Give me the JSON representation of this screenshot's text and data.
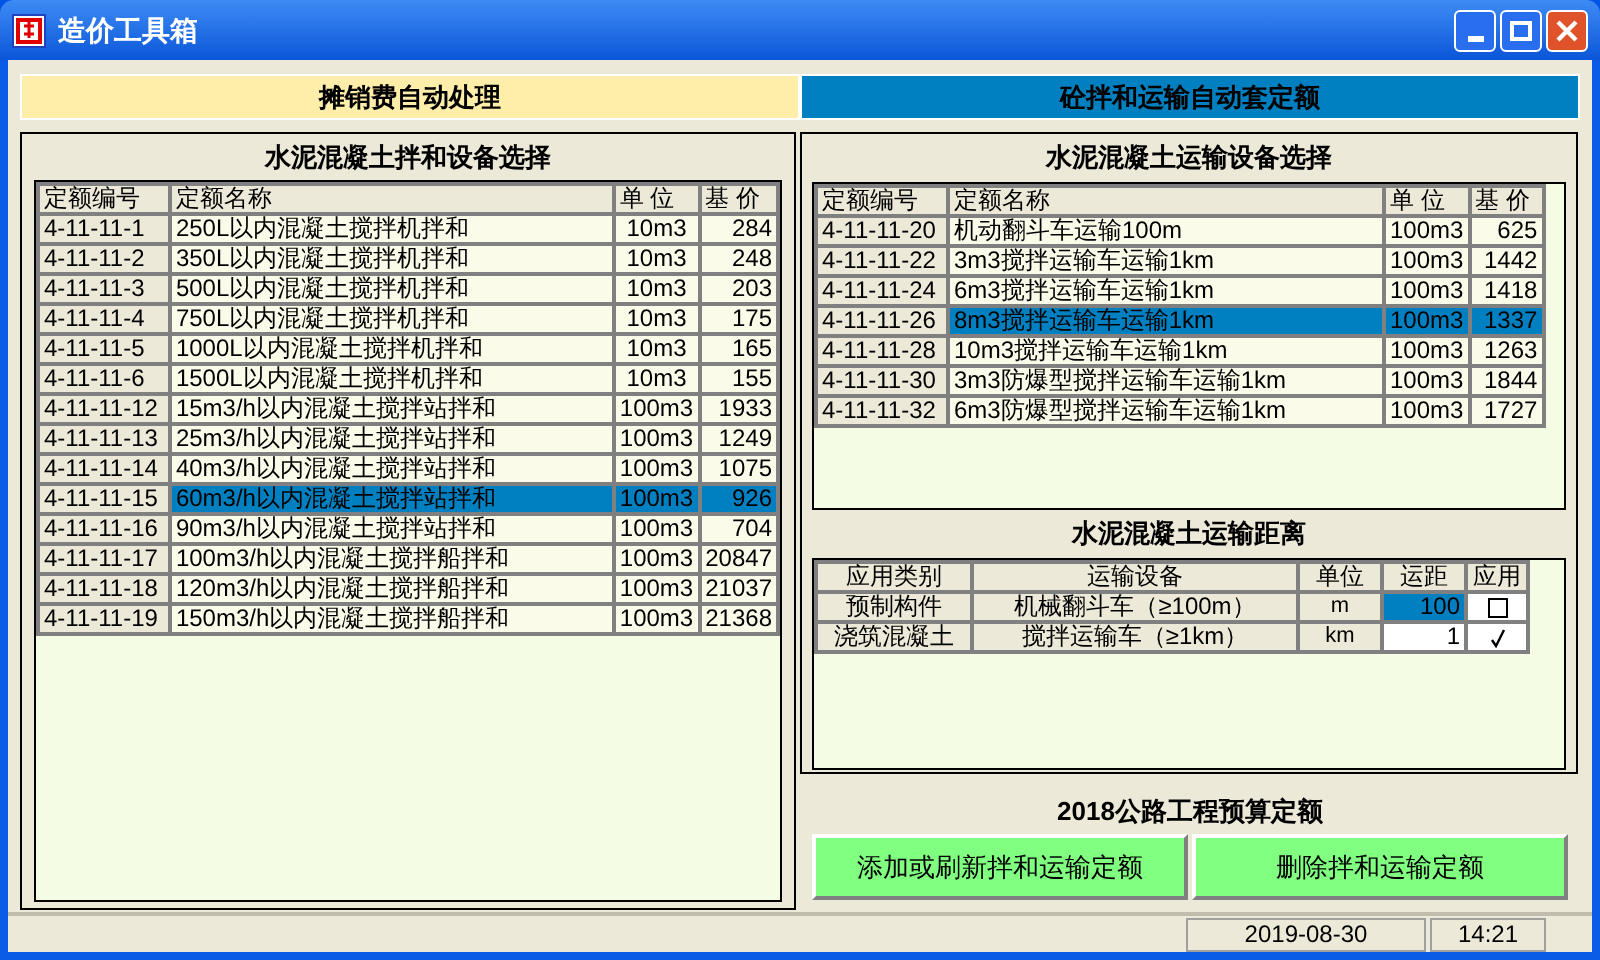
{
  "window": {
    "title": "造价工具箱"
  },
  "tabs": [
    {
      "label": "摊销费自动处理",
      "selected": false
    },
    {
      "label": "砼拌和运输自动套定额",
      "selected": true
    }
  ],
  "mix_panel": {
    "title": "水泥混凝土拌和设备选择",
    "columns": [
      "定额编号",
      "定额名称",
      "单 位",
      "基 价"
    ],
    "rows": [
      {
        "code": "4-11-11-1",
        "name": "250L以内混凝土搅拌机拌和",
        "unit": "10m3",
        "price": "284",
        "selected": false
      },
      {
        "code": "4-11-11-2",
        "name": "350L以内混凝土搅拌机拌和",
        "unit": "10m3",
        "price": "248",
        "selected": false
      },
      {
        "code": "4-11-11-3",
        "name": "500L以内混凝土搅拌机拌和",
        "unit": "10m3",
        "price": "203",
        "selected": false
      },
      {
        "code": "4-11-11-4",
        "name": "750L以内混凝土搅拌机拌和",
        "unit": "10m3",
        "price": "175",
        "selected": false
      },
      {
        "code": "4-11-11-5",
        "name": "1000L以内混凝土搅拌机拌和",
        "unit": "10m3",
        "price": "165",
        "selected": false
      },
      {
        "code": "4-11-11-6",
        "name": "1500L以内混凝土搅拌机拌和",
        "unit": "10m3",
        "price": "155",
        "selected": false
      },
      {
        "code": "4-11-11-12",
        "name": "15m3/h以内混凝土搅拌站拌和",
        "unit": "100m3",
        "price": "1933",
        "selected": false
      },
      {
        "code": "4-11-11-13",
        "name": "25m3/h以内混凝土搅拌站拌和",
        "unit": "100m3",
        "price": "1249",
        "selected": false
      },
      {
        "code": "4-11-11-14",
        "name": "40m3/h以内混凝土搅拌站拌和",
        "unit": "100m3",
        "price": "1075",
        "selected": false
      },
      {
        "code": "4-11-11-15",
        "name": "60m3/h以内混凝土搅拌站拌和",
        "unit": "100m3",
        "price": "926",
        "selected": true
      },
      {
        "code": "4-11-11-16",
        "name": "90m3/h以内混凝土搅拌站拌和",
        "unit": "100m3",
        "price": "704",
        "selected": false
      },
      {
        "code": "4-11-11-17",
        "name": "100m3/h以内混凝土搅拌船拌和",
        "unit": "100m3",
        "price": "20847",
        "selected": false
      },
      {
        "code": "4-11-11-18",
        "name": "120m3/h以内混凝土搅拌船拌和",
        "unit": "100m3",
        "price": "21037",
        "selected": false
      },
      {
        "code": "4-11-11-19",
        "name": "150m3/h以内混凝土搅拌船拌和",
        "unit": "100m3",
        "price": "21368",
        "selected": false
      }
    ]
  },
  "transport_panel": {
    "title": "水泥混凝土运输设备选择",
    "columns": [
      "定额编号",
      "定额名称",
      "单 位",
      "基 价"
    ],
    "rows": [
      {
        "code": "4-11-11-20",
        "name": "机动翻斗车运输100m",
        "unit": "100m3",
        "price": "625",
        "selected": false
      },
      {
        "code": "4-11-11-22",
        "name": "3m3搅拌运输车运输1km",
        "unit": "100m3",
        "price": "1442",
        "selected": false
      },
      {
        "code": "4-11-11-24",
        "name": "6m3搅拌运输车运输1km",
        "unit": "100m3",
        "price": "1418",
        "selected": false
      },
      {
        "code": "4-11-11-26",
        "name": "8m3搅拌运输车运输1km",
        "unit": "100m3",
        "price": "1337",
        "selected": true
      },
      {
        "code": "4-11-11-28",
        "name": "10m3搅拌运输车运输1km",
        "unit": "100m3",
        "price": "1263",
        "selected": false
      },
      {
        "code": "4-11-11-30",
        "name": "3m3防爆型搅拌运输车运输1km",
        "unit": "100m3",
        "price": "1844",
        "selected": false
      },
      {
        "code": "4-11-11-32",
        "name": "6m3防爆型搅拌运输车运输1km",
        "unit": "100m3",
        "price": "1727",
        "selected": false
      }
    ]
  },
  "distance": {
    "title": "水泥混凝土运输距离",
    "columns": [
      "应用类别",
      "运输设备",
      "单位",
      "运距",
      "应用"
    ],
    "rows": [
      {
        "category": "预制构件",
        "equipment": "机械翻斗车（≥100m）",
        "unit": "m",
        "distance": "100",
        "selected": true,
        "checked": false
      },
      {
        "category": "浇筑混凝土",
        "equipment": "搅拌运输车（≥1km）",
        "unit": "km",
        "distance": "1",
        "selected": false,
        "checked": true
      }
    ]
  },
  "quota_title": "2018公路工程预算定额",
  "buttons": [
    "添加或刷新拌和运输定额",
    "删除拌和运输定额"
  ],
  "status_bar": {
    "date": "2019-08-30",
    "time": "14:21"
  }
}
